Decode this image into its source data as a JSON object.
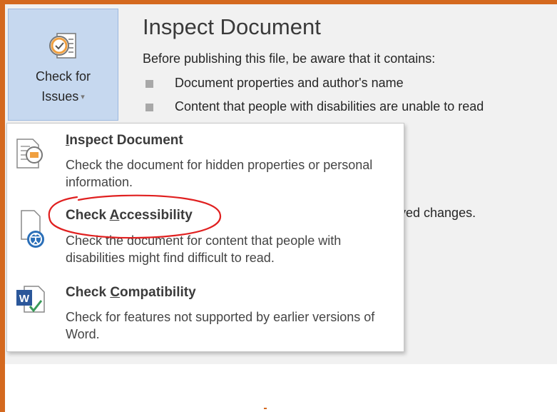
{
  "check_button": {
    "line1": "Check for",
    "line2": "Issues",
    "caret": "▾",
    "icon": "check-for-issues-icon"
  },
  "inspect_section": {
    "title": "Inspect Document",
    "description": "Before publishing this file, be aware that it contains:",
    "bullets": [
      "Document properties and author's name",
      "Content that people with disabilities are unable to read"
    ],
    "partial_text": "ved changes."
  },
  "menu": {
    "items": [
      {
        "title_before": "",
        "title_access": "I",
        "title_after": "nspect Document",
        "description": "Check the document for hidden properties or personal information.",
        "icon": "inspect-document-icon"
      },
      {
        "title_before": "Check ",
        "title_access": "A",
        "title_after": "ccessibility",
        "description": "Check the document for content that people with disabilities might find difficult to read.",
        "icon": "check-accessibility-icon"
      },
      {
        "title_before": "Check ",
        "title_access": "C",
        "title_after": "ompatibility",
        "description": "Check for features not supported by earlier versions of Word.",
        "icon": "check-compatibility-icon"
      }
    ]
  },
  "colors": {
    "frame_orange": "#d4691f",
    "button_bg": "#c6d8ef",
    "annotation_red": "#e02020",
    "word_blue": "#2b579a"
  }
}
